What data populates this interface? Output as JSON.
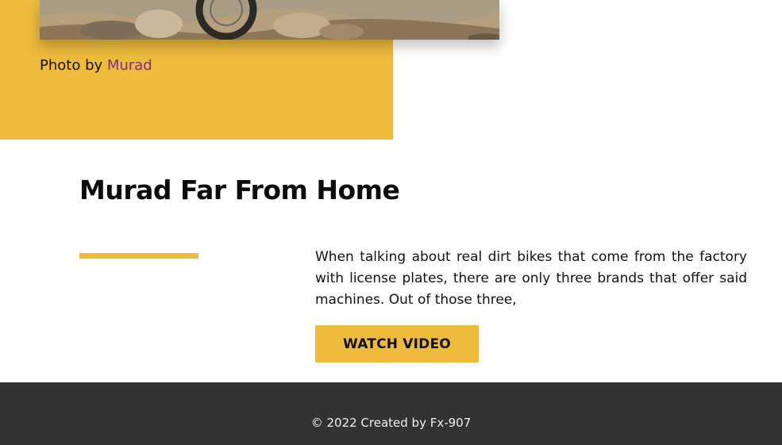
{
  "hero": {
    "photo_alt": "motorcycle on desert trail",
    "credit_prefix": "Photo by",
    "credit_name": "Murad"
  },
  "article": {
    "title": "Murad Far From Home",
    "body": "When talking about real dirt bikes that come from the factory with license plates, there are only three brands that offer said machines. Out of those three,",
    "cta_label": "WATCH VIDEO"
  },
  "footer": {
    "text": "© 2022 Created by Fx-907"
  },
  "colors": {
    "accent": "#eebb3c",
    "link": "#7a2f8f",
    "footer_bg": "#323232"
  }
}
